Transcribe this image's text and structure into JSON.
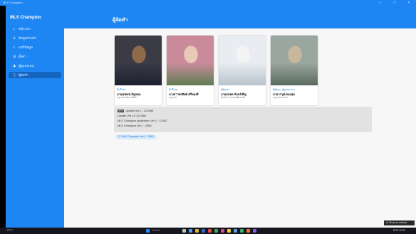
{
  "window": {
    "title": "MLS Champion"
  },
  "sidebar": {
    "title": "MLS Champion",
    "items": [
      {
        "icon": "home-icon",
        "glyph": "⌂",
        "label": "หน้าแรก"
      },
      {
        "icon": "person-icon",
        "glyph": "♙",
        "label": "ข้อมูลส่วนตัว"
      },
      {
        "icon": "share-icon",
        "glyph": "<",
        "label": "แชร์ข้อมูล"
      },
      {
        "icon": "settings-icon",
        "glyph": "⚙",
        "label": "ตั้งค่า"
      },
      {
        "icon": "users-icon",
        "glyph": "♟",
        "label": "ผู้ดูแลระบบ"
      },
      {
        "icon": "info-icon",
        "glyph": "ⓘ",
        "label": "ผู้จัดทำ"
      }
    ],
    "active_index": 5
  },
  "main": {
    "title": "ผู้จัดทำ"
  },
  "developers": [
    {
      "role": "ที่ปรึกษา",
      "name": "นายสุรพงษ์ ธัญหอม",
      "sub": "ครู กศน.อำเภอเมือง",
      "photo_colors": [
        "#3b3b46",
        "#8d6b4a",
        "#1c2030"
      ]
    },
    {
      "role": "ที่ปรึกษา",
      "name": "นางสาวพรทิพย์ ศรีทองดี",
      "sub": "ครู กศน.",
      "photo_colors": [
        "#c98b9a",
        "#e8c9b8",
        "#5f7d52"
      ]
    },
    {
      "role": "ผู้พัฒนา",
      "name": "นายธนพล จันทร์เพ็ญ",
      "sub": "นักวิชาการคอมพิวเตอร์",
      "photo_colors": [
        "#e9edf2",
        "#f4f4f4",
        "#b7c2cc"
      ]
    },
    {
      "role": "ผู้พัฒนา ผู้ดูแลระบบ",
      "name": "นายวรวุฒิ ทองสุข",
      "sub": "ครู กศน.ตำบล",
      "photo_colors": [
        "#9aa6a0",
        "#c8b79d",
        "#5a6b5e"
      ]
    }
  ],
  "version_info": {
    "badge": "NEW",
    "lines": [
      "Update Ver.1 : 12/2565",
      "Update Ver.2.5  12/2566",
      "MLS Champion application Ver.2 : 1/2567",
      "MLS Champion  Ver.1 : 2565"
    ]
  },
  "chip": {
    "label": "MLS Champion Ver.1 : 2565"
  },
  "toast": {
    "label": "Show on website"
  },
  "taskbar": {
    "left_text": "27°C",
    "search_label": "Search",
    "right_text": "ENG 20:41"
  }
}
